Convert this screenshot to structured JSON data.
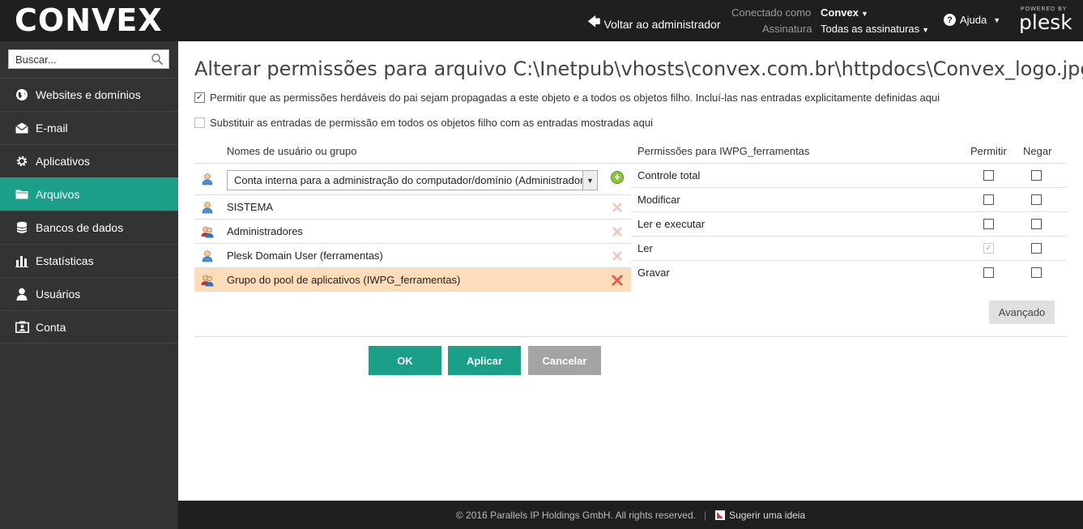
{
  "header": {
    "logo": "CONVEX",
    "back_link": "Voltar ao administrador",
    "connected_label": "Conectado como",
    "connected_value": "Convex",
    "subscription_label": "Assinatura",
    "subscription_value": "Todas as assinaturas",
    "help": "Ajuda",
    "powered_by": "POWERED BY",
    "plesk": "plesk"
  },
  "sidebar": {
    "search_placeholder": "Buscar...",
    "items": [
      {
        "label": "Websites e domínios",
        "icon": "globe-icon",
        "active": false
      },
      {
        "label": "E-mail",
        "icon": "envelope-icon",
        "active": false
      },
      {
        "label": "Aplicativos",
        "icon": "gear-icon",
        "active": false
      },
      {
        "label": "Arquivos",
        "icon": "folder-icon",
        "active": true
      },
      {
        "label": "Bancos de dados",
        "icon": "database-icon",
        "active": false
      },
      {
        "label": "Estatísticas",
        "icon": "bar-chart-icon",
        "active": false
      },
      {
        "label": "Usuários",
        "icon": "user-icon",
        "active": false
      },
      {
        "label": "Conta",
        "icon": "account-card-icon",
        "active": false
      }
    ]
  },
  "main": {
    "title": "Alterar permissões para arquivo C:\\Inetpub\\vhosts\\convex.com.br\\httpdocs\\Convex_logo.jpg",
    "option_inherit": {
      "label": "Permitir que as permissões herdáveis do pai sejam propagadas a este objeto e a todos os objetos filho. Incluí-las nas entradas explicitamente definidas aqui",
      "checked": true
    },
    "option_replace": {
      "label": "Substituir as entradas de permissão em todos os objetos filho com as entradas mostradas aqui",
      "checked": false
    },
    "users_header": "Nomes de usuário ou grupo",
    "user_select_value": "Conta interna para a administração do computador/domínio (Administrador)",
    "users": [
      {
        "name": "SISTEMA",
        "icon": "user-icon",
        "selected": false
      },
      {
        "name": "Administradores",
        "icon": "group-icon",
        "selected": false
      },
      {
        "name": "Plesk Domain User (ferramentas)",
        "icon": "user-icon",
        "selected": false
      },
      {
        "name": "Grupo do pool de aplicativos (IWPG_ferramentas)",
        "icon": "group-icon",
        "selected": true
      }
    ],
    "permissions_header": "Permissões para IWPG_ferramentas",
    "allow_header": "Permitir",
    "deny_header": "Negar",
    "permissions": [
      {
        "name": "Controle total",
        "allow": false,
        "deny": false,
        "allow_disabled": false
      },
      {
        "name": "Modificar",
        "allow": false,
        "deny": false,
        "allow_disabled": false
      },
      {
        "name": "Ler e executar",
        "allow": false,
        "deny": false,
        "allow_disabled": false
      },
      {
        "name": "Ler",
        "allow": true,
        "deny": false,
        "allow_disabled": true
      },
      {
        "name": "Gravar",
        "allow": false,
        "deny": false,
        "allow_disabled": false
      }
    ],
    "advanced_button": "Avançado",
    "ok_button": "OK",
    "apply_button": "Aplicar",
    "cancel_button": "Cancelar"
  },
  "footer": {
    "copyright": "© 2016 Parallels IP Holdings GmbH. All rights reserved.",
    "suggest": "Sugerir uma ideia"
  },
  "colors": {
    "accent": "#1b9f89",
    "header_bg": "#1f1f1f",
    "sidebar_bg": "#333333",
    "selected_row": "#fcdcb9",
    "cancel_bg": "#a4a4a4",
    "delete_red": "#e85a4f"
  }
}
